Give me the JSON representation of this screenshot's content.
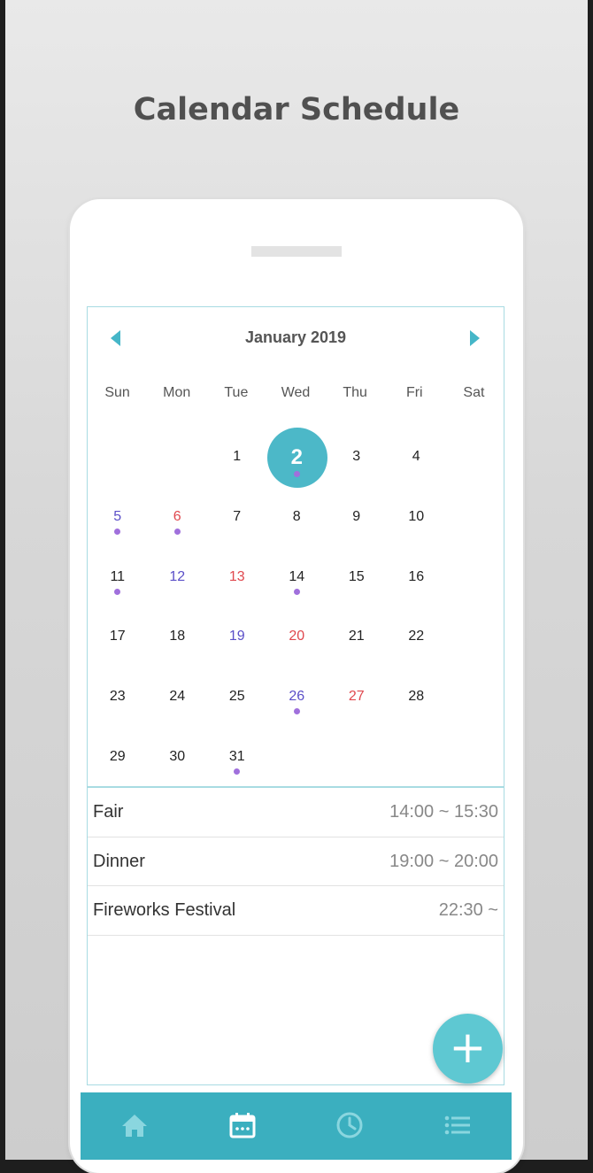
{
  "app": {
    "title": "Calendar Schedule"
  },
  "calendar": {
    "month_label": "January 2019",
    "weekdays": [
      "Sun",
      "Mon",
      "Tue",
      "Wed",
      "Thu",
      "Fri",
      "Sat"
    ],
    "leading_blanks": 2,
    "days": [
      {
        "n": "1",
        "dot": false
      },
      {
        "n": "2",
        "dot": true,
        "selected": true
      },
      {
        "n": "3",
        "dot": false
      },
      {
        "n": "4",
        "dot": false
      },
      {
        "n": "5",
        "dot": true
      },
      {
        "n": "6",
        "dot": true
      },
      {
        "n": "7",
        "dot": false
      },
      {
        "n": "8",
        "dot": false
      },
      {
        "n": "9",
        "dot": false
      },
      {
        "n": "10",
        "dot": false
      },
      {
        "n": "11",
        "dot": true
      },
      {
        "n": "12",
        "dot": false
      },
      {
        "n": "13",
        "dot": false
      },
      {
        "n": "14",
        "dot": true
      },
      {
        "n": "15",
        "dot": false
      },
      {
        "n": "16",
        "dot": false
      },
      {
        "n": "17",
        "dot": false
      },
      {
        "n": "18",
        "dot": false
      },
      {
        "n": "19",
        "dot": false
      },
      {
        "n": "20",
        "dot": false
      },
      {
        "n": "21",
        "dot": false
      },
      {
        "n": "22",
        "dot": false
      },
      {
        "n": "23",
        "dot": false
      },
      {
        "n": "24",
        "dot": false
      },
      {
        "n": "25",
        "dot": false
      },
      {
        "n": "26",
        "dot": true
      },
      {
        "n": "27",
        "dot": false
      },
      {
        "n": "28",
        "dot": false
      },
      {
        "n": "29",
        "dot": false
      },
      {
        "n": "30",
        "dot": false
      },
      {
        "n": "31",
        "dot": true
      }
    ],
    "selected_day": "2"
  },
  "events": [
    {
      "title": "Fair",
      "time": "14:00 ~ 15:30"
    },
    {
      "title": "Dinner",
      "time": "19:00 ~ 20:00"
    },
    {
      "title": "Fireworks Festival",
      "time": "22:30 ~"
    }
  ],
  "fab": {
    "icon": "plus-icon",
    "symbol": "+"
  },
  "tabs": [
    {
      "icon": "home-icon",
      "active": false
    },
    {
      "icon": "calendar-icon",
      "active": true
    },
    {
      "icon": "clock-icon",
      "active": false
    },
    {
      "icon": "list-icon",
      "active": false
    }
  ],
  "colors": {
    "accent": "#4cb8c8",
    "tabbar": "#3bafbf",
    "sunday": "#e0484e",
    "saturday": "#5b4fc8",
    "event_dot": "#a070dc",
    "icon_inactive": "#8ad6df",
    "icon_active": "#ffffff"
  }
}
